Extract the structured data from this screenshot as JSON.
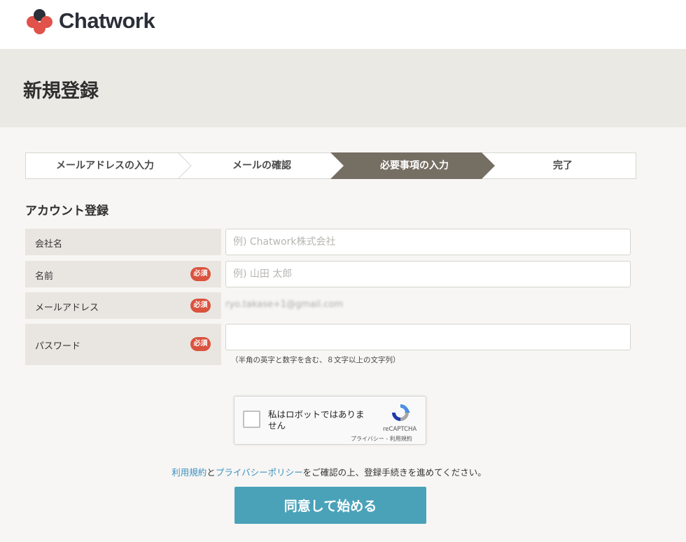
{
  "header": {
    "logo_text": "Chatwork",
    "logo_colors": [
      "#e0524a",
      "#e0524a",
      "#2a2f38",
      "#e0524a"
    ]
  },
  "page": {
    "title": "新規登録"
  },
  "steps": {
    "items": [
      {
        "label": "メールアドレスの入力",
        "active": false
      },
      {
        "label": "メールの確認",
        "active": false
      },
      {
        "label": "必要事項の入力",
        "active": true
      },
      {
        "label": "完了",
        "active": false
      }
    ],
    "active_color": "#756e63"
  },
  "form": {
    "section_title": "アカウント登録",
    "required_badge": "必須",
    "company": {
      "label": "会社名",
      "placeholder": "例) Chatwork株式会社",
      "value": ""
    },
    "name": {
      "label": "名前",
      "placeholder": "例) 山田 太郎",
      "value": ""
    },
    "email": {
      "label": "メールアドレス",
      "value": "ryo.takase+1@gmail.com"
    },
    "password": {
      "label": "パスワード",
      "value": "",
      "hint": "（半角の英字と数字を含む、８文字以上の文字列）"
    }
  },
  "recaptcha": {
    "checkbox_label": "私はロボットではありません",
    "brand": "reCAPTCHA",
    "links": "プライバシー - 利用規約"
  },
  "consent": {
    "terms_link": "利用規約",
    "and": "と",
    "privacy_link": "プライバシーポリシー",
    "rest": "をご確認の上、登録手続きを進めてください。"
  },
  "submit": {
    "label": "同意して始める",
    "color": "#4aa2b9"
  }
}
